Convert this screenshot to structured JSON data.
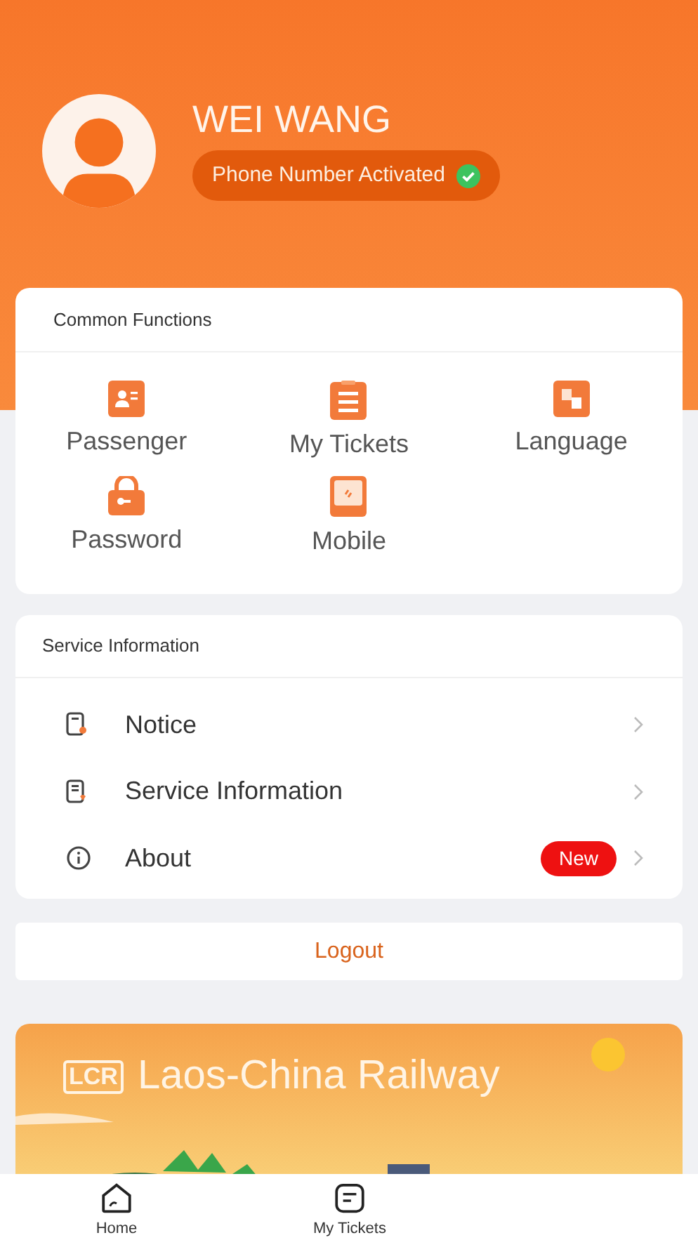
{
  "profile": {
    "name": "WEI WANG",
    "status": "Phone Number Activated",
    "verified": true
  },
  "common_functions": {
    "title": "Common Functions",
    "items": [
      {
        "label": "Passenger"
      },
      {
        "label": "My Tickets"
      },
      {
        "label": "Language"
      },
      {
        "label": "Password"
      },
      {
        "label": "Mobile"
      }
    ]
  },
  "service_information": {
    "title": "Service Information",
    "items": [
      {
        "label": "Notice"
      },
      {
        "label": "Service Information"
      },
      {
        "label": "About",
        "badge": "New"
      }
    ]
  },
  "logout": "Logout",
  "banner": {
    "logo": "LCR",
    "title": "Laos-China Railway"
  },
  "bottom_nav": [
    {
      "label": "Home"
    },
    {
      "label": "My Tickets"
    }
  ]
}
